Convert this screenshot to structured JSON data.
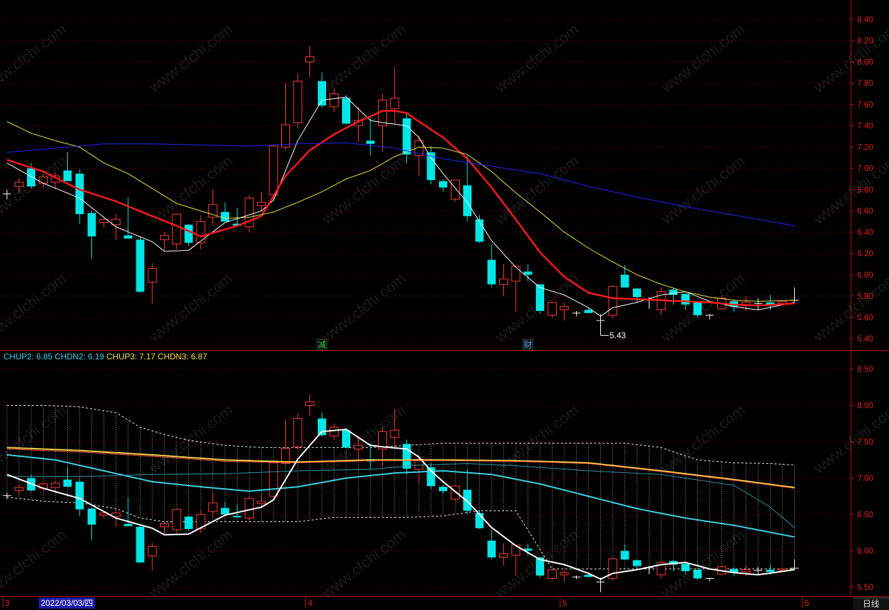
{
  "colors": {
    "up": "#ff3b3b",
    "down": "#00e5e5",
    "ma5": "#ffffff",
    "ma10": "#ff2020",
    "ma20": "#e8e84a",
    "ma60": "#2828ff",
    "axis": "#c01010",
    "chup2": "#3cd2e6",
    "chdn2": "#3cd2e6",
    "chup3": "#f2e24a",
    "chdn3": "#f2e24a"
  },
  "watermark": "www.cfchi.com",
  "indicator_legend": [
    {
      "key": "CHUP2",
      "value": "6.85",
      "text": "CHUP2: 6.85",
      "color": "#3cd2e6"
    },
    {
      "key": "CHDN2",
      "value": "6.19",
      "text": "CHDN2: 6.19",
      "color": "#3cd2e6"
    },
    {
      "key": "CHUP3",
      "value": "7.17",
      "text": "CHUP3: 7.17",
      "color": "#f2e24a"
    },
    {
      "key": "CHDN3",
      "value": "6.87",
      "text": "CHDN3: 6.87",
      "color": "#f2e24a"
    }
  ],
  "markers": [
    {
      "text": "减",
      "candle_index": 26
    },
    {
      "text": "财",
      "candle_index": 43
    }
  ],
  "low_annotation": "5.43",
  "bottom_axis": {
    "month_labels": [
      {
        "text": "3",
        "candle_index": 0
      },
      {
        "text": "4",
        "candle_index": 25
      },
      {
        "text": "5",
        "candle_index": 46
      },
      {
        "text": "6",
        "candle_index": 66
      }
    ],
    "cursor_date": "2022/03/03/四",
    "period_button": "日线"
  },
  "chart_data": [
    {
      "type": "candlestick",
      "title": "",
      "ylim": [
        5.3,
        8.45
      ],
      "y_ticks": [
        "5.40",
        "5.60",
        "5.80",
        "6.00",
        "6.20",
        "6.40",
        "6.60",
        "6.80",
        "7.00",
        "7.20",
        "7.40",
        "7.60",
        "7.80",
        "8.00",
        "8.20",
        "8.40"
      ],
      "ohlc": [
        [
          6.76,
          6.8,
          6.71,
          6.76
        ],
        [
          6.83,
          6.91,
          6.77,
          6.87
        ],
        [
          7.0,
          7.05,
          6.81,
          6.83
        ],
        [
          6.86,
          6.94,
          6.82,
          6.92
        ],
        [
          6.87,
          6.96,
          6.8,
          6.93
        ],
        [
          6.98,
          7.15,
          6.91,
          6.88
        ],
        [
          6.95,
          6.99,
          6.48,
          6.57
        ],
        [
          6.58,
          6.6,
          6.15,
          6.36
        ],
        [
          6.49,
          6.53,
          6.44,
          6.52
        ],
        [
          6.47,
          6.57,
          6.33,
          6.52
        ],
        [
          6.37,
          6.73,
          6.36,
          6.34
        ],
        [
          6.33,
          6.36,
          5.83,
          5.84
        ],
        [
          5.93,
          6.11,
          5.73,
          6.06
        ],
        [
          6.33,
          6.4,
          6.23,
          6.37
        ],
        [
          6.29,
          6.57,
          6.24,
          6.57
        ],
        [
          6.47,
          6.48,
          6.27,
          6.3
        ],
        [
          6.3,
          6.56,
          6.24,
          6.5
        ],
        [
          6.54,
          6.8,
          6.46,
          6.66
        ],
        [
          6.59,
          6.68,
          6.52,
          6.5
        ],
        [
          6.48,
          6.63,
          6.46,
          6.46
        ],
        [
          6.45,
          6.75,
          6.4,
          6.72
        ],
        [
          6.65,
          6.78,
          6.6,
          6.68
        ],
        [
          6.75,
          7.22,
          6.7,
          7.21
        ],
        [
          7.2,
          7.8,
          7.18,
          7.41
        ],
        [
          7.43,
          7.89,
          7.38,
          7.82
        ],
        [
          8.0,
          8.15,
          7.86,
          8.05
        ],
        [
          7.82,
          7.9,
          7.57,
          7.59
        ],
        [
          7.58,
          7.75,
          7.53,
          7.7
        ],
        [
          7.66,
          7.69,
          7.41,
          7.42
        ],
        [
          7.4,
          7.58,
          7.25,
          7.45
        ],
        [
          7.26,
          7.48,
          7.12,
          7.23
        ],
        [
          7.4,
          7.7,
          7.16,
          7.64
        ],
        [
          7.56,
          7.95,
          7.42,
          7.66
        ],
        [
          7.47,
          7.53,
          7.05,
          7.13
        ],
        [
          7.12,
          7.31,
          6.93,
          7.26
        ],
        [
          7.15,
          7.21,
          6.85,
          6.89
        ],
        [
          6.88,
          6.9,
          6.78,
          6.82
        ],
        [
          6.71,
          6.85,
          6.69,
          6.89
        ],
        [
          6.84,
          7.12,
          6.5,
          6.55
        ],
        [
          6.52,
          6.56,
          6.3,
          6.31
        ],
        [
          6.14,
          6.29,
          5.88,
          5.91
        ],
        [
          5.91,
          6.1,
          5.8,
          5.96
        ],
        [
          5.94,
          6.04,
          5.65,
          6.08
        ],
        [
          6.03,
          6.1,
          5.94,
          6.0
        ],
        [
          5.91,
          5.9,
          5.63,
          5.66
        ],
        [
          5.62,
          5.73,
          5.6,
          5.74
        ],
        [
          5.67,
          5.74,
          5.57,
          5.7
        ],
        [
          5.63,
          5.66,
          5.61,
          5.64
        ],
        [
          5.67,
          5.69,
          5.64,
          5.64
        ],
        [
          5.57,
          5.63,
          5.43,
          5.56
        ],
        [
          5.62,
          5.9,
          5.59,
          5.89
        ],
        [
          6.0,
          6.09,
          5.89,
          5.88
        ],
        [
          5.87,
          5.88,
          5.74,
          5.79
        ],
        [
          5.76,
          5.79,
          5.68,
          5.77
        ],
        [
          5.67,
          5.88,
          5.62,
          5.84
        ],
        [
          5.86,
          5.87,
          5.72,
          5.81
        ],
        [
          5.82,
          5.83,
          5.67,
          5.72
        ],
        [
          5.74,
          5.74,
          5.6,
          5.62
        ],
        [
          5.62,
          5.63,
          5.58,
          5.61
        ],
        [
          5.68,
          5.8,
          5.67,
          5.78
        ],
        [
          5.75,
          5.77,
          5.65,
          5.7
        ],
        [
          5.71,
          5.8,
          5.66,
          5.74
        ],
        [
          5.72,
          5.78,
          5.67,
          5.73
        ],
        [
          5.74,
          5.81,
          5.67,
          5.71
        ],
        [
          5.73,
          5.76,
          5.72,
          5.75
        ],
        [
          5.75,
          5.88,
          5.74,
          5.76
        ]
      ],
      "series": [
        {
          "name": "MA5",
          "color": "#ffffff",
          "width": 1,
          "x": [
            0,
            3,
            6,
            9,
            12,
            13,
            15,
            18,
            21,
            22,
            24,
            26,
            28,
            30,
            31,
            33,
            34,
            35,
            36,
            38,
            40,
            42,
            44,
            46,
            48,
            49,
            50,
            52,
            54,
            56,
            58,
            60,
            62,
            65
          ],
          "values": [
            7.05,
            6.86,
            6.72,
            6.45,
            6.31,
            6.22,
            6.23,
            6.49,
            6.6,
            6.7,
            7.26,
            7.64,
            7.67,
            7.45,
            7.43,
            7.4,
            7.29,
            7.1,
            6.95,
            6.68,
            6.32,
            6.07,
            5.88,
            5.81,
            5.69,
            5.61,
            5.69,
            5.74,
            5.81,
            5.84,
            5.75,
            5.7,
            5.67,
            5.74
          ]
        },
        {
          "name": "MA10",
          "color": "#ff1a1a",
          "width": 2.5,
          "x": [
            0,
            3,
            6,
            9,
            12,
            14,
            16,
            19,
            21,
            23,
            25,
            27,
            29,
            31,
            32,
            33,
            34,
            36,
            38,
            40,
            42,
            44,
            46,
            48,
            50,
            52,
            54,
            56,
            58,
            60,
            62,
            65
          ],
          "values": [
            7.08,
            6.97,
            6.8,
            6.69,
            6.55,
            6.46,
            6.36,
            6.46,
            6.55,
            6.93,
            7.17,
            7.32,
            7.44,
            7.54,
            7.54,
            7.52,
            7.44,
            7.29,
            7.09,
            6.82,
            6.52,
            6.21,
            5.98,
            5.83,
            5.78,
            5.77,
            5.76,
            5.75,
            5.74,
            5.72,
            5.71,
            5.73
          ]
        },
        {
          "name": "MA20",
          "color": "#e6e64a",
          "width": 1,
          "x": [
            0,
            2,
            4,
            6,
            8,
            10,
            12,
            14,
            16,
            18,
            20,
            22,
            24,
            26,
            28,
            30,
            32,
            34,
            36,
            38,
            40,
            42,
            44,
            46,
            48,
            50,
            52,
            54,
            56,
            58,
            60,
            62,
            65
          ],
          "values": [
            7.44,
            7.33,
            7.26,
            7.2,
            7.05,
            6.95,
            6.81,
            6.67,
            6.6,
            6.53,
            6.54,
            6.59,
            6.68,
            6.78,
            6.9,
            6.98,
            7.11,
            7.2,
            7.19,
            7.13,
            6.97,
            6.77,
            6.59,
            6.4,
            6.25,
            6.12,
            6.0,
            5.91,
            5.84,
            5.79,
            5.76,
            5.75,
            5.76
          ]
        },
        {
          "name": "MA60",
          "color": "#2424ff",
          "width": 1,
          "x": [
            0,
            4,
            8,
            12,
            16,
            20,
            24,
            28,
            32,
            36,
            40,
            44,
            48,
            52,
            56,
            60,
            65
          ],
          "values": [
            7.15,
            7.19,
            7.23,
            7.23,
            7.22,
            7.21,
            7.23,
            7.24,
            7.19,
            7.09,
            7.02,
            6.95,
            6.83,
            6.73,
            6.64,
            6.56,
            6.46
          ]
        }
      ]
    },
    {
      "type": "channel-indicator",
      "title": "",
      "ylim": [
        5.45,
        8.65
      ],
      "y_ticks": [
        "5.50",
        "6.00",
        "6.50",
        "7.00",
        "7.50",
        "8.00",
        "8.50"
      ],
      "band_upper": {
        "x": [
          0,
          3,
          6,
          9,
          11,
          13,
          15,
          18,
          21,
          24,
          27,
          30,
          33,
          36,
          39,
          42,
          45,
          48,
          51,
          54,
          57,
          60,
          63,
          65
        ],
        "values": [
          8.0,
          8.0,
          7.98,
          7.9,
          7.7,
          7.6,
          7.52,
          7.45,
          7.42,
          7.42,
          7.42,
          7.42,
          7.45,
          7.48,
          7.48,
          7.48,
          7.48,
          7.48,
          7.48,
          7.42,
          7.25,
          7.21,
          7.2,
          7.18
        ]
      },
      "band_lower": {
        "x": [
          0,
          3,
          6,
          9,
          11,
          13,
          15,
          18,
          21,
          24,
          27,
          30,
          33,
          36,
          39,
          42,
          45,
          48,
          51,
          54,
          57,
          60,
          63,
          65
        ],
        "values": [
          6.74,
          6.68,
          6.66,
          6.58,
          6.45,
          6.4,
          6.4,
          6.4,
          6.4,
          6.4,
          6.46,
          6.46,
          6.46,
          6.48,
          6.55,
          6.55,
          5.75,
          5.75,
          5.75,
          5.75,
          5.75,
          5.75,
          5.75,
          5.75
        ]
      },
      "series": [
        {
          "name": "CHUP2",
          "color": "#3cd2e6",
          "width": 2,
          "x": [
            0,
            4,
            8,
            12,
            16,
            20,
            24,
            28,
            32,
            36,
            40,
            44,
            48,
            52,
            56,
            60,
            65
          ],
          "values": [
            7.32,
            7.25,
            7.1,
            6.95,
            6.88,
            6.82,
            6.88,
            7.0,
            7.07,
            7.1,
            7.05,
            6.92,
            6.75,
            6.58,
            6.45,
            6.35,
            6.19
          ]
        },
        {
          "name": "CHDN2",
          "color": "#2c9aaa",
          "width": 1,
          "x": [
            0,
            6,
            12,
            18,
            24,
            30,
            34,
            38,
            42,
            48,
            54,
            60,
            63,
            65
          ],
          "values": [
            7.02,
            7.02,
            7.05,
            7.06,
            7.1,
            7.12,
            7.18,
            7.2,
            7.17,
            7.1,
            7.05,
            6.9,
            6.6,
            6.32
          ]
        },
        {
          "name": "CHUP3",
          "color": "#f2d04a",
          "width": 2,
          "x": [
            0,
            6,
            12,
            18,
            24,
            30,
            36,
            42,
            48,
            54,
            60,
            65
          ],
          "values": [
            7.42,
            7.38,
            7.32,
            7.25,
            7.22,
            7.25,
            7.25,
            7.24,
            7.21,
            7.1,
            6.98,
            6.87
          ]
        },
        {
          "name": "CHDN3",
          "color": "#ff5a3a",
          "width": 1,
          "x": [
            0,
            6,
            12,
            18,
            24,
            30,
            36,
            42,
            48,
            54,
            60,
            65
          ],
          "values": [
            7.4,
            7.36,
            7.3,
            7.23,
            7.21,
            7.24,
            7.24,
            7.23,
            7.2,
            7.09,
            6.97,
            6.86
          ]
        },
        {
          "name": "MA5",
          "color": "#ffffff",
          "width": 2,
          "x": [
            0,
            3,
            6,
            9,
            12,
            13,
            15,
            18,
            21,
            22,
            24,
            26,
            28,
            30,
            31,
            33,
            34,
            35,
            36,
            38,
            40,
            42,
            44,
            46,
            48,
            49,
            50,
            52,
            54,
            56,
            58,
            60,
            62,
            65
          ],
          "values": [
            7.05,
            6.86,
            6.72,
            6.45,
            6.31,
            6.22,
            6.23,
            6.49,
            6.6,
            6.7,
            7.26,
            7.64,
            7.67,
            7.45,
            7.43,
            7.4,
            7.29,
            7.1,
            6.95,
            6.68,
            6.32,
            6.07,
            5.88,
            5.81,
            5.69,
            5.61,
            5.69,
            5.74,
            5.81,
            5.84,
            5.75,
            5.7,
            5.67,
            5.74
          ]
        }
      ]
    }
  ]
}
